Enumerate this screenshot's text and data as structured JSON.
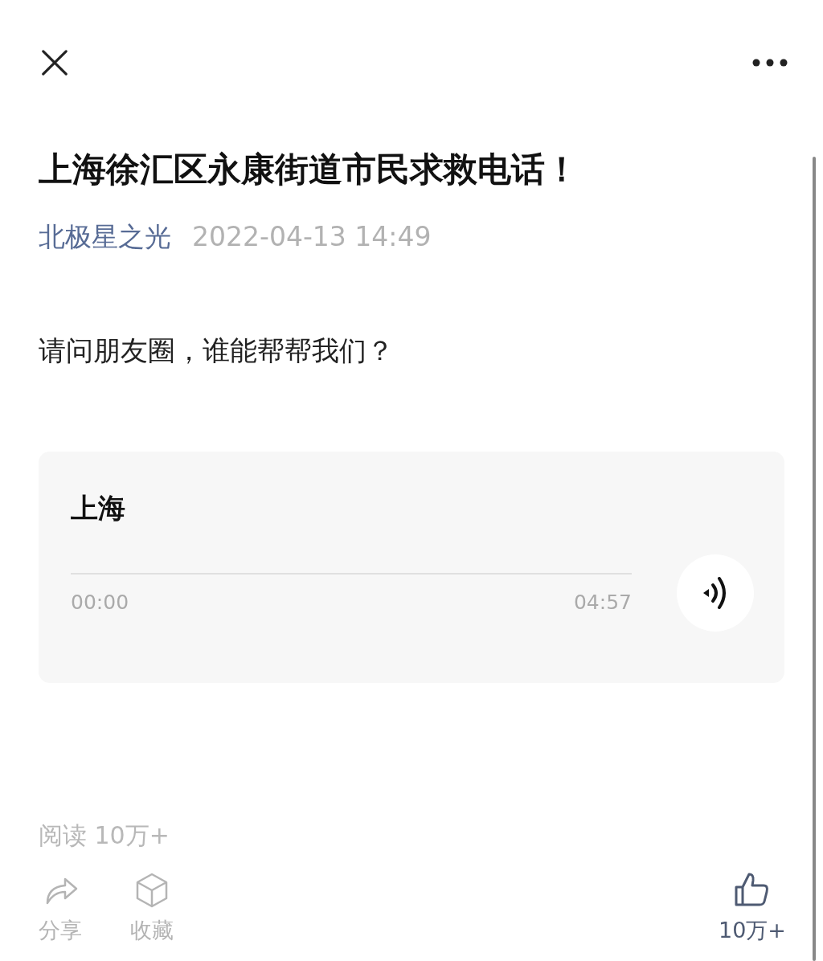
{
  "article": {
    "title": "上海徐汇区永康街道市民求救电话！",
    "author": "北极星之光",
    "date": "2022-04-13 14:49",
    "body": "请问朋友圈，谁能帮帮我们？"
  },
  "audio": {
    "title": "上海",
    "level": 0,
    "current_time": "00:00",
    "duration": "04:57"
  },
  "reads": "阅读 10万+",
  "actions": [
    {
      "kind": "share",
      "label": "分享",
      "disabled": true
    },
    {
      "kind": "collect",
      "label": "收藏",
      "disabled": true
    }
  ],
  "like": {
    "count": "10万+"
  }
}
